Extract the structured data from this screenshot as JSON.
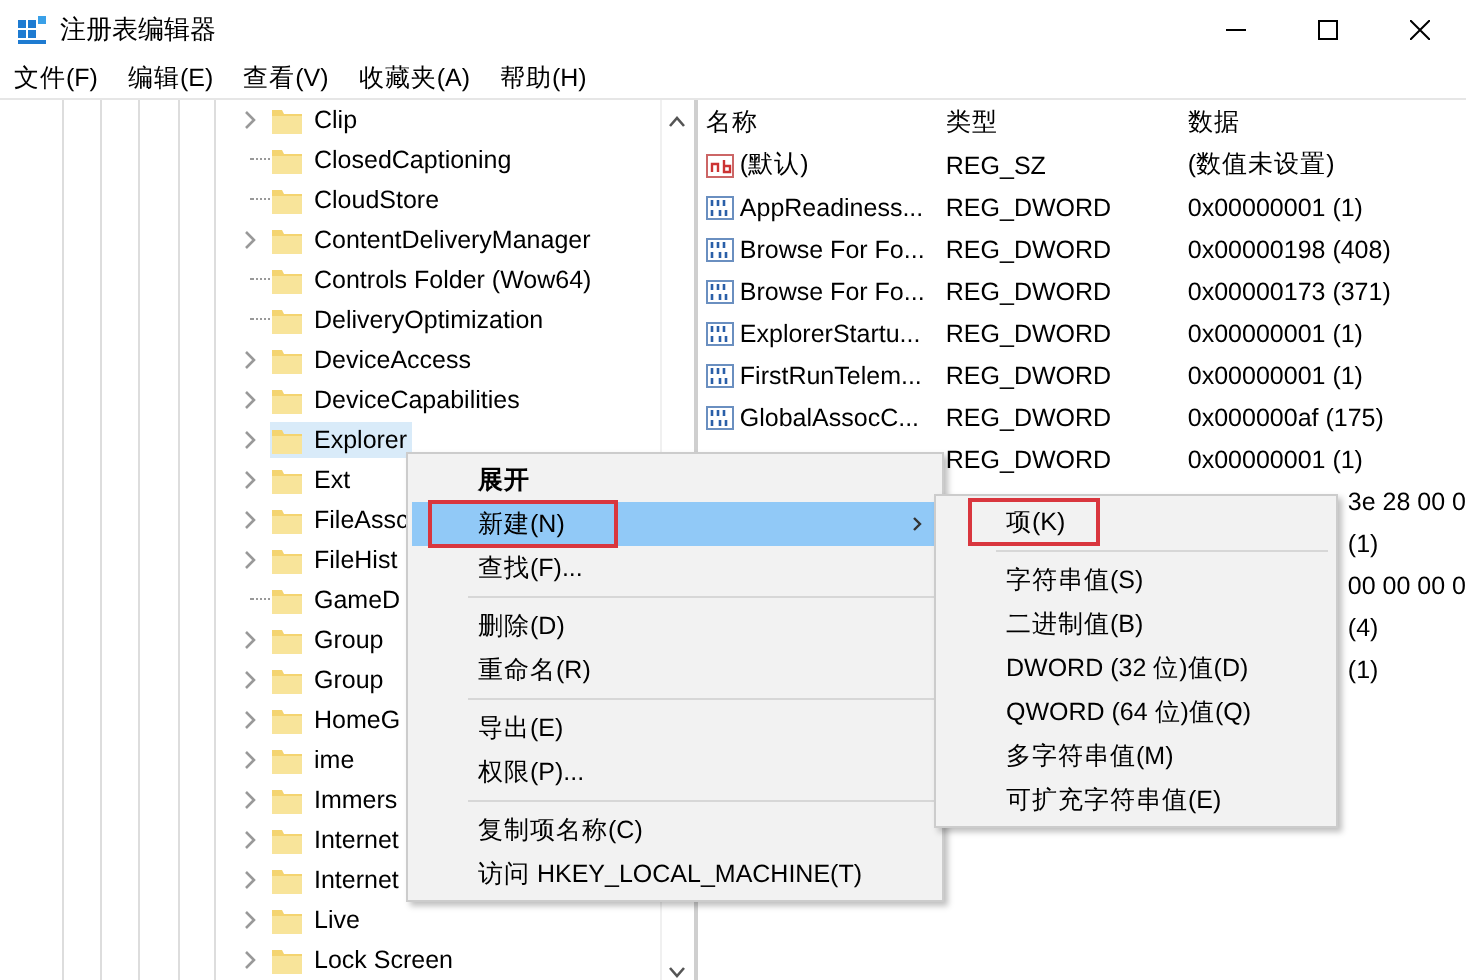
{
  "window": {
    "title": "注册表编辑器"
  },
  "menu_bar": [
    "文件(F)",
    "编辑(E)",
    "查看(V)",
    "收藏夹(A)",
    "帮助(H)"
  ],
  "tree": [
    {
      "label": "Clip",
      "expandable": true,
      "selected": false
    },
    {
      "label": "ClosedCaptioning",
      "expandable": false,
      "selected": false
    },
    {
      "label": "CloudStore",
      "expandable": false,
      "selected": false
    },
    {
      "label": "ContentDeliveryManager",
      "expandable": true,
      "selected": false
    },
    {
      "label": "Controls Folder (Wow64)",
      "expandable": false,
      "selected": false
    },
    {
      "label": "DeliveryOptimization",
      "expandable": false,
      "selected": false
    },
    {
      "label": "DeviceAccess",
      "expandable": true,
      "selected": false
    },
    {
      "label": "DeviceCapabilities",
      "expandable": true,
      "selected": false
    },
    {
      "label": "Explorer",
      "expandable": true,
      "selected": true
    },
    {
      "label": "Ext",
      "expandable": true,
      "selected": false
    },
    {
      "label": "FileAssc",
      "expandable": true,
      "selected": false
    },
    {
      "label": "FileHist",
      "expandable": true,
      "selected": false
    },
    {
      "label": "GameD",
      "expandable": false,
      "selected": false
    },
    {
      "label": "Group",
      "expandable": true,
      "selected": false
    },
    {
      "label": "Group",
      "expandable": true,
      "selected": false
    },
    {
      "label": "HomeG",
      "expandable": true,
      "selected": false
    },
    {
      "label": "ime",
      "expandable": true,
      "selected": false
    },
    {
      "label": "Immers",
      "expandable": true,
      "selected": false
    },
    {
      "label": "Internet",
      "expandable": true,
      "selected": false
    },
    {
      "label": "Internet",
      "expandable": true,
      "selected": false
    },
    {
      "label": "Live",
      "expandable": true,
      "selected": false
    },
    {
      "label": "Lock Screen",
      "expandable": true,
      "selected": false
    }
  ],
  "values": {
    "columns": [
      "名称",
      "类型",
      "数据"
    ],
    "rows": [
      {
        "kind": "string",
        "name": "(默认)",
        "type": "REG_SZ",
        "data": "(数值未设置)"
      },
      {
        "kind": "binary",
        "name": "AppReadiness...",
        "type": "REG_DWORD",
        "data": "0x00000001 (1)"
      },
      {
        "kind": "binary",
        "name": "Browse For Fo...",
        "type": "REG_DWORD",
        "data": "0x00000198 (408)"
      },
      {
        "kind": "binary",
        "name": "Browse For Fo...",
        "type": "REG_DWORD",
        "data": "0x00000173 (371)"
      },
      {
        "kind": "binary",
        "name": "ExplorerStartu...",
        "type": "REG_DWORD",
        "data": "0x00000001 (1)"
      },
      {
        "kind": "binary",
        "name": "FirstRunTelem...",
        "type": "REG_DWORD",
        "data": "0x00000001 (1)"
      },
      {
        "kind": "binary",
        "name": "GlobalAssocC...",
        "type": "REG_DWORD",
        "data": "0x000000af (175)"
      },
      {
        "kind": "nameless",
        "type": "REG_DWORD",
        "data": "0x00000001 (1)"
      },
      {
        "kind": "fragment",
        "data": "3e 28 00 0"
      },
      {
        "kind": "fragment",
        "data": "(1)"
      },
      {
        "kind": "fragment",
        "data": "00 00 00 0"
      },
      {
        "kind": "fragment",
        "data": "(4)"
      },
      {
        "kind": "fragment",
        "data": "(1)"
      }
    ]
  },
  "context_menu": {
    "items": [
      {
        "kind": "item",
        "label": "展开",
        "bold": true,
        "selected": false,
        "submenu": false,
        "annotated": false
      },
      {
        "kind": "item",
        "label": "新建(N)",
        "bold": false,
        "selected": true,
        "submenu": true,
        "annotated": true
      },
      {
        "kind": "item",
        "label": "查找(F)...",
        "bold": false,
        "selected": false,
        "submenu": false,
        "annotated": false
      },
      {
        "kind": "separator"
      },
      {
        "kind": "item",
        "label": "删除(D)",
        "bold": false,
        "selected": false,
        "submenu": false,
        "annotated": false
      },
      {
        "kind": "item",
        "label": "重命名(R)",
        "bold": false,
        "selected": false,
        "submenu": false,
        "annotated": false
      },
      {
        "kind": "separator"
      },
      {
        "kind": "item",
        "label": "导出(E)",
        "bold": false,
        "selected": false,
        "submenu": false,
        "annotated": false
      },
      {
        "kind": "item",
        "label": "权限(P)...",
        "bold": false,
        "selected": false,
        "submenu": false,
        "annotated": false
      },
      {
        "kind": "separator"
      },
      {
        "kind": "item",
        "label": "复制项名称(C)",
        "bold": false,
        "selected": false,
        "submenu": false,
        "annotated": false
      },
      {
        "kind": "item",
        "label": "访问 HKEY_LOCAL_MACHINE(T)",
        "bold": false,
        "selected": false,
        "submenu": false,
        "annotated": false
      }
    ]
  },
  "submenu": {
    "items": [
      {
        "kind": "item",
        "label": "项(K)",
        "annotated": true
      },
      {
        "kind": "separator"
      },
      {
        "kind": "item",
        "label": "字符串值(S)",
        "annotated": false
      },
      {
        "kind": "item",
        "label": "二进制值(B)",
        "annotated": false
      },
      {
        "kind": "item",
        "label": "DWORD (32 位)值(D)",
        "annotated": false
      },
      {
        "kind": "item",
        "label": "QWORD (64 位)值(Q)",
        "annotated": false
      },
      {
        "kind": "item",
        "label": "多字符串值(M)",
        "annotated": false
      },
      {
        "kind": "item",
        "label": "可扩充字符串值(E)",
        "annotated": false
      }
    ]
  }
}
